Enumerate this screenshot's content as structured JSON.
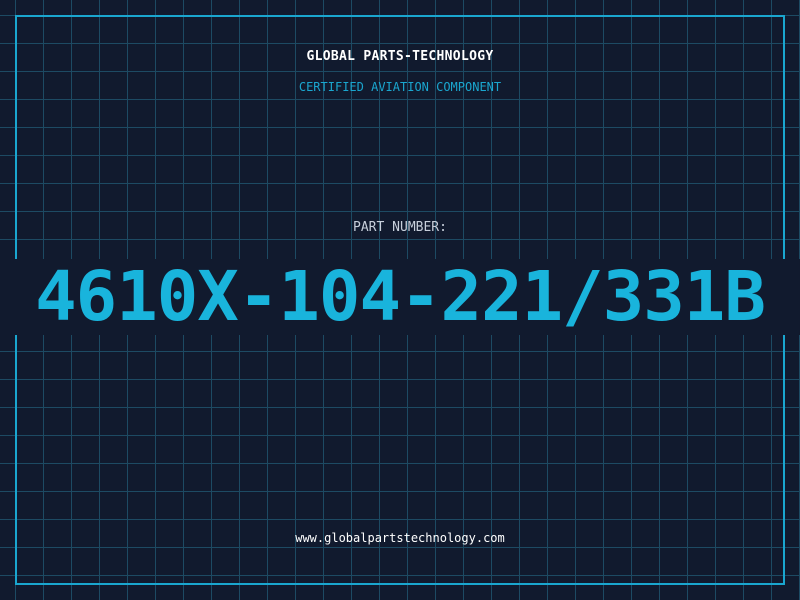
{
  "header": {
    "company": "GLOBAL PARTS-TECHNOLOGY",
    "subtitle": "CERTIFIED AVIATION COMPONENT"
  },
  "part": {
    "label": "PART NUMBER:",
    "number": "4610X-104-221/331B"
  },
  "footer": {
    "url": "www.globalpartstechnology.com"
  },
  "colors": {
    "background": "#111a2e",
    "grid": "#1d4a63",
    "accent": "#1aa6cf",
    "part_number": "#19b4dc",
    "text": "#ffffff"
  }
}
